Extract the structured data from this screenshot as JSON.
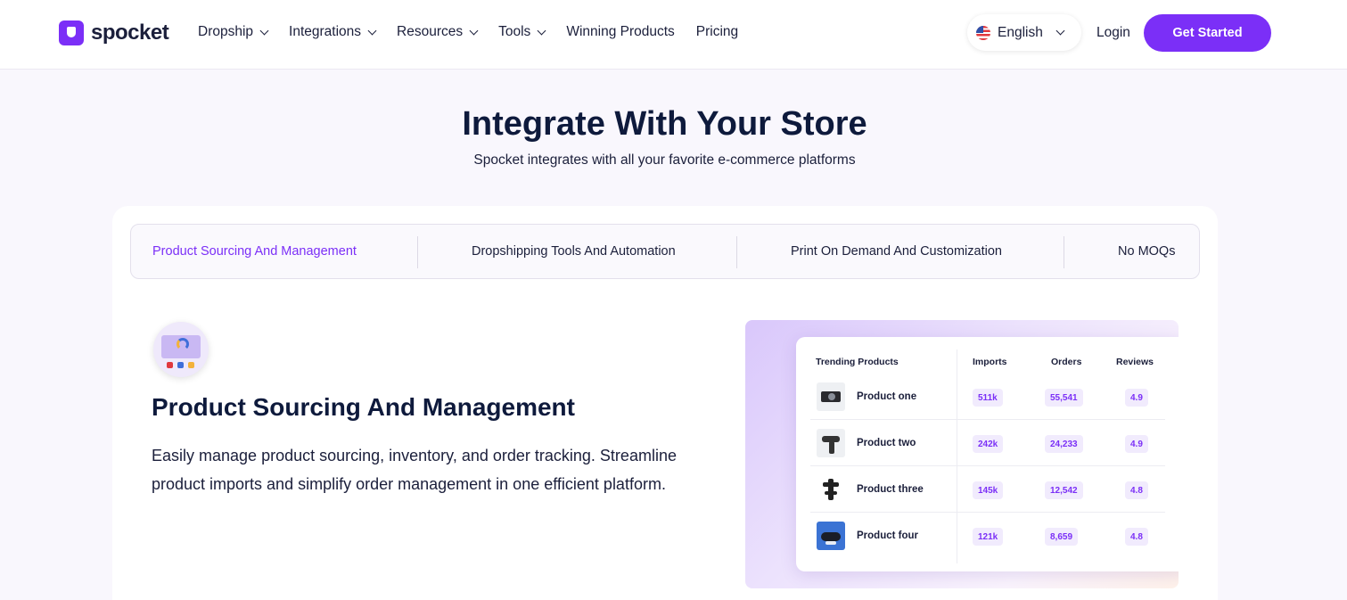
{
  "brand": {
    "name": "spocket",
    "color": "#7b2ff7",
    "icon": "spocket-logo-icon"
  },
  "nav": {
    "items": [
      {
        "label": "Dropship",
        "has_dropdown": true
      },
      {
        "label": "Integrations",
        "has_dropdown": true
      },
      {
        "label": "Resources",
        "has_dropdown": true
      },
      {
        "label": "Tools",
        "has_dropdown": true
      },
      {
        "label": "Winning Products",
        "has_dropdown": false
      },
      {
        "label": "Pricing",
        "has_dropdown": false
      }
    ],
    "language": {
      "label": "English",
      "icon": "us-flag-icon"
    },
    "login": "Login",
    "cta": "Get Started"
  },
  "hero": {
    "title": "Integrate With Your Store",
    "subtitle": "Spocket integrates with all your favorite e-commerce platforms"
  },
  "tabs": [
    {
      "label": "Product Sourcing And Management",
      "active": true
    },
    {
      "label": "Dropshipping Tools And Automation",
      "active": false
    },
    {
      "label": "Print On Demand And Customization",
      "active": false
    },
    {
      "label": "No MOQs",
      "active": false
    }
  ],
  "feature": {
    "icon": "product-sourcing-icon",
    "title": "Product Sourcing And Management",
    "description": "Easily manage product sourcing, inventory, and order tracking. Streamline product imports and simplify order management in one efficient platform."
  },
  "preview_table": {
    "headers": {
      "product": "Trending Products",
      "imports": "Imports",
      "orders": "Orders",
      "reviews": "Reviews"
    },
    "rows": [
      {
        "name": "Product one",
        "imports": "511k",
        "orders": "55,541",
        "reviews": "4.9",
        "thumb_icon": "camera-icon"
      },
      {
        "name": "Product two",
        "imports": "242k",
        "orders": "24,233",
        "reviews": "4.9",
        "thumb_icon": "massage-gun-icon"
      },
      {
        "name": "Product three",
        "imports": "145k",
        "orders": "12,542",
        "reviews": "4.8",
        "thumb_icon": "gimbal-icon"
      },
      {
        "name": "Product four",
        "imports": "121k",
        "orders": "8,659",
        "reviews": "4.8",
        "thumb_icon": "bike-icon"
      }
    ]
  }
}
